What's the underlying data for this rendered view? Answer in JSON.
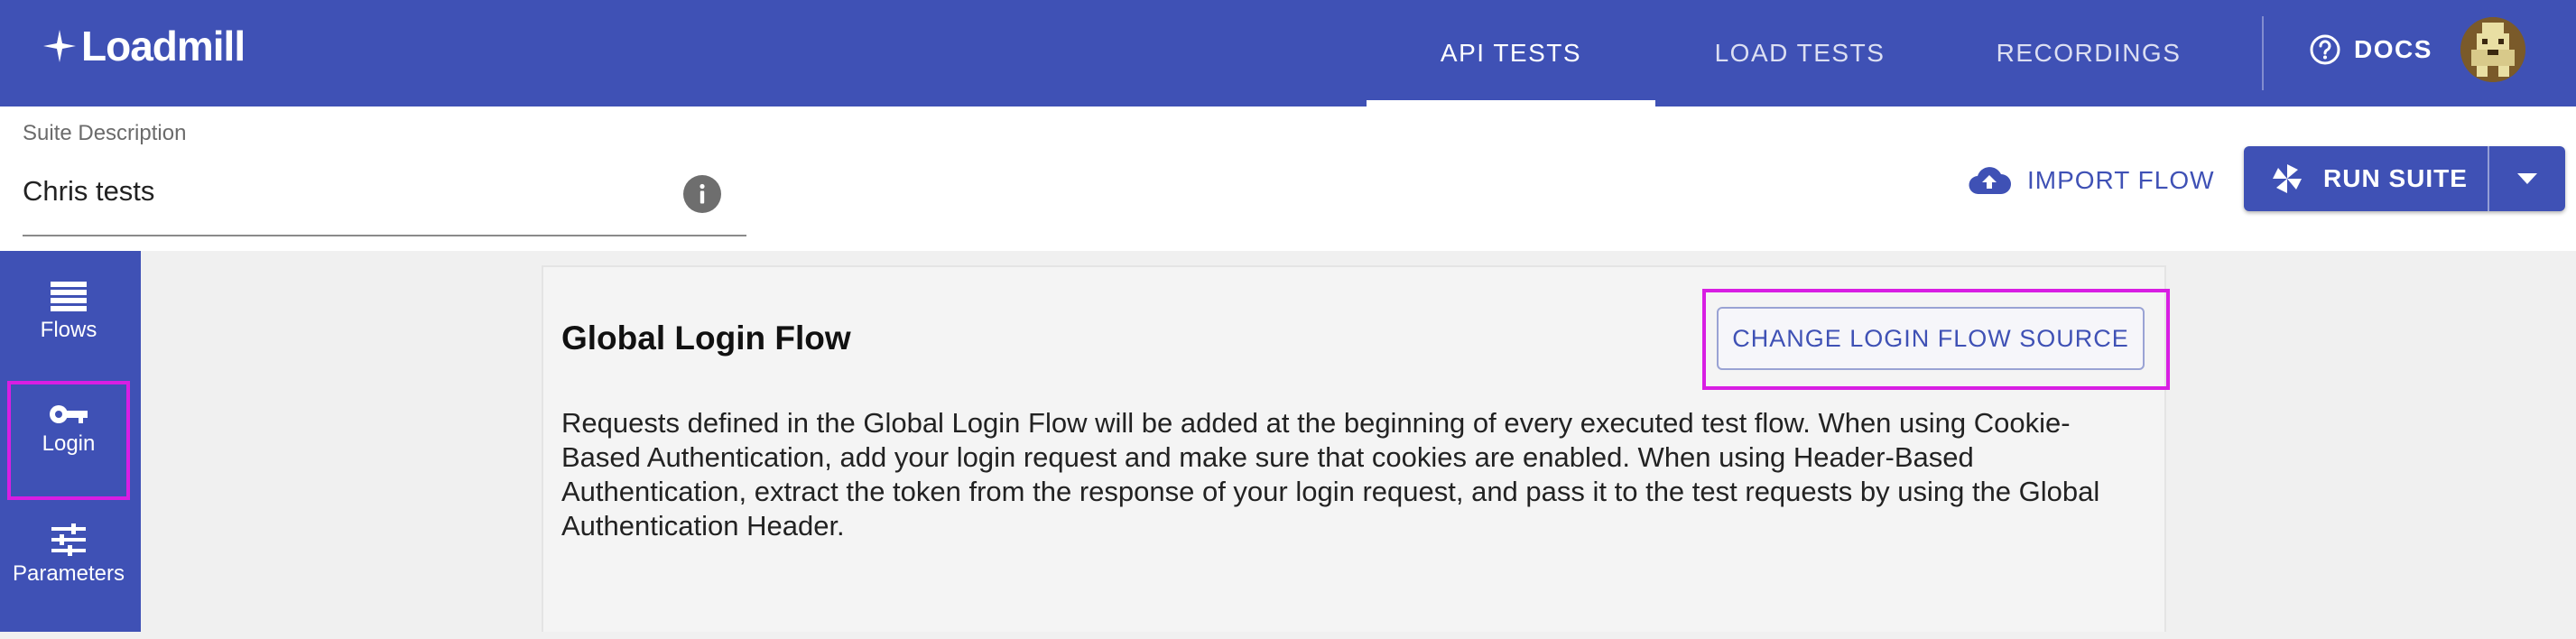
{
  "header": {
    "logo": "Loadmill",
    "tabs": [
      {
        "label": "API TESTS",
        "active": true
      },
      {
        "label": "LOAD TESTS",
        "active": false
      },
      {
        "label": "RECORDINGS",
        "active": false
      }
    ],
    "docs_label": "DOCS",
    "docs_icon": "help-circle-icon",
    "avatar_icon": "pixel-avatar"
  },
  "suite": {
    "description_label": "Suite Description",
    "description_value": "Chris tests",
    "info_icon": "info-icon"
  },
  "actions": {
    "import_label": "IMPORT FLOW",
    "import_icon": "cloud-upload-icon",
    "run_label": "RUN SUITE",
    "run_icon": "pinwheel-icon",
    "run_menu_icon": "caret-down-icon"
  },
  "sidebar": {
    "items": [
      {
        "label": "Flows",
        "icon": "list-icon",
        "selected": false
      },
      {
        "label": "Login",
        "icon": "key-icon",
        "selected": true
      },
      {
        "label": "Parameters",
        "icon": "sliders-icon",
        "selected": false
      }
    ]
  },
  "login_panel": {
    "title": "Global Login Flow",
    "change_source_label": "CHANGE LOGIN FLOW SOURCE",
    "description": "Requests defined in the Global Login Flow will be added at the beginning of every executed test flow. When using Cookie-Based Authentication, add your login request and make sure that cookies are enabled. When using Header-Based Authentication, extract the token from the response of your login request, and pass it to the test requests by using the Global Authentication Header."
  },
  "colors": {
    "primary": "#3f51b5",
    "highlight": "#d81ee3",
    "background": "#f0f0f0"
  }
}
